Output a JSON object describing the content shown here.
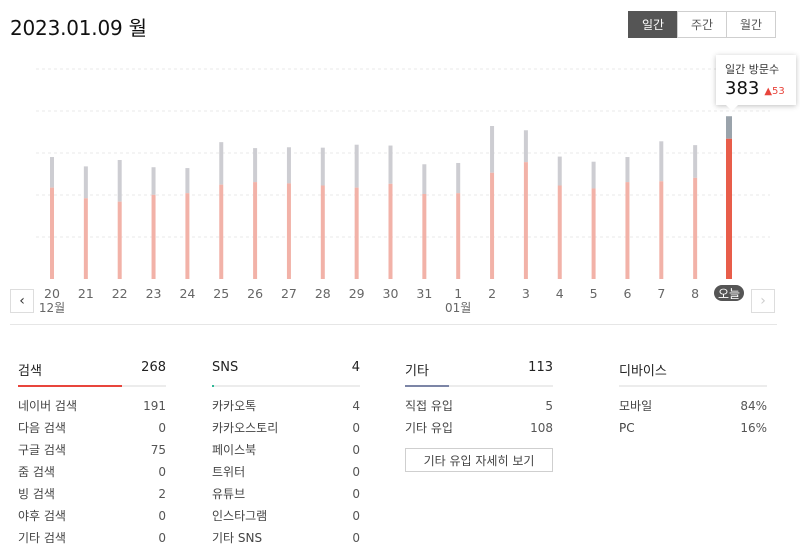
{
  "header": {
    "date": "2023.01.09 월",
    "period_tabs": [
      "일간",
      "주간",
      "월간"
    ],
    "active_period": 0
  },
  "tooltip": {
    "label": "일간 방문수",
    "value": "383",
    "delta": "▲53"
  },
  "colors": {
    "bar_main": "#f2b2a8",
    "bar_rest": "#cdcdd2",
    "today_main": "#e85d4a",
    "today_rest": "#9aa3ab",
    "accent_search": "#e8453c",
    "accent_sns": "#2fb896",
    "accent_etc": "#7c85a6"
  },
  "chart_data": {
    "type": "bar",
    "stacked": true,
    "categories": [
      "20",
      "21",
      "22",
      "23",
      "24",
      "25",
      "26",
      "27",
      "28",
      "29",
      "30",
      "31",
      "1",
      "2",
      "3",
      "4",
      "5",
      "6",
      "7",
      "8",
      "오늘"
    ],
    "month_labels": [
      {
        "at": "20",
        "text": "12월"
      },
      {
        "at": "1",
        "text": "01월"
      }
    ],
    "series": [
      {
        "values": [
          215,
          190,
          182,
          198,
          202,
          222,
          228,
          225,
          220,
          215,
          224,
          200,
          202,
          250,
          275,
          220,
          213,
          228,
          230,
          238,
          330
        ]
      },
      {
        "values": [
          72,
          75,
          98,
          65,
          59,
          100,
          80,
          85,
          89,
          101,
          90,
          70,
          71,
          110,
          75,
          68,
          63,
          59,
          94,
          77,
          53
        ]
      }
    ],
    "ylim": [
      0,
      480
    ],
    "grid": true
  },
  "stats": {
    "search": {
      "title": "검색",
      "total": "268",
      "rows": [
        {
          "label": "네이버 검색",
          "value": "191"
        },
        {
          "label": "다음 검색",
          "value": "0"
        },
        {
          "label": "구글 검색",
          "value": "75"
        },
        {
          "label": "줌 검색",
          "value": "0"
        },
        {
          "label": "빙 검색",
          "value": "2"
        },
        {
          "label": "야후 검색",
          "value": "0"
        },
        {
          "label": "기타 검색",
          "value": "0"
        }
      ],
      "share": 0.7
    },
    "sns": {
      "title": "SNS",
      "total": "4",
      "rows": [
        {
          "label": "카카오톡",
          "value": "4"
        },
        {
          "label": "카카오스토리",
          "value": "0"
        },
        {
          "label": "페이스북",
          "value": "0"
        },
        {
          "label": "트위터",
          "value": "0"
        },
        {
          "label": "유튜브",
          "value": "0"
        },
        {
          "label": "인스타그램",
          "value": "0"
        },
        {
          "label": "기타 SNS",
          "value": "0"
        }
      ],
      "share": 0.01
    },
    "etc": {
      "title": "기타",
      "total": "113",
      "rows": [
        {
          "label": "직접 유입",
          "value": "5"
        },
        {
          "label": "기타 유입",
          "value": "108"
        }
      ],
      "more_label": "기타 유입 자세히 보기",
      "share": 0.3
    },
    "device": {
      "title": "디바이스",
      "total": "",
      "rows": [
        {
          "label": "모바일",
          "value": "84%"
        },
        {
          "label": "PC",
          "value": "16%"
        }
      ]
    }
  },
  "nav": {
    "prev_icon": "chevron-left-icon",
    "next_icon": "chevron-right-icon",
    "prev_glyph": "‹",
    "next_glyph": "›"
  }
}
